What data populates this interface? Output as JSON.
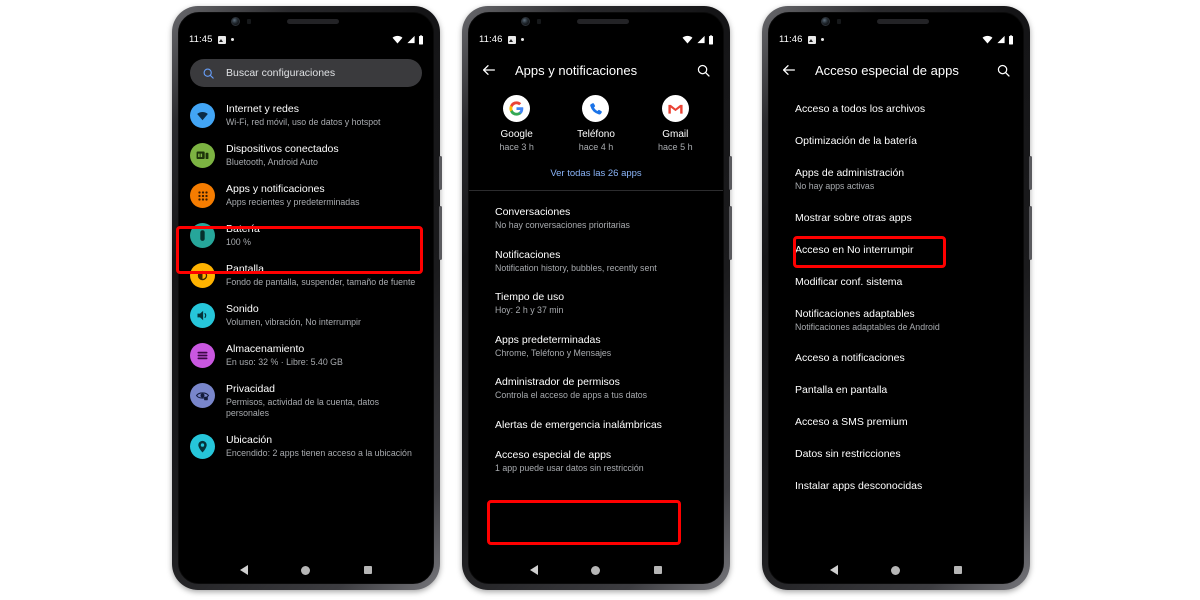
{
  "accent": {
    "red_highlight": "#ff0000",
    "link_blue": "#8ab4f8",
    "screen_bg": "#000000",
    "search_bg": "#3a3a3d",
    "secondary_text": "#a8abaf"
  },
  "phone1": {
    "status": {
      "time": "11:45",
      "icons": [
        "photo-icon",
        "dot-icon",
        "wifi-icon",
        "signal-icon",
        "battery-icon"
      ]
    },
    "search": {
      "placeholder": "Buscar configuraciones",
      "icon": "search-icon"
    },
    "settings": [
      {
        "title": "Internet y redes",
        "subtitle": "Wi-Fi, red móvil, uso de datos y hotspot",
        "icon": "wifi-icon",
        "color": "#42a5f5"
      },
      {
        "title": "Dispositivos conectados",
        "subtitle": "Bluetooth, Android Auto",
        "icon": "devices-icon",
        "color": "#7cb342"
      },
      {
        "title": "Apps y notificaciones",
        "subtitle": "Apps recientes y predeterminadas",
        "icon": "apps-grid-icon",
        "color": "#f57c00"
      },
      {
        "title": "Batería",
        "subtitle": "100 %",
        "icon": "battery-icon",
        "color": "#26a69a"
      },
      {
        "title": "Pantalla",
        "subtitle": "Fondo de pantalla, suspender, tamaño de fuente",
        "icon": "brightness-icon",
        "color": "#ffb300"
      },
      {
        "title": "Sonido",
        "subtitle": "Volumen, vibración, No interrumpir",
        "icon": "volume-icon",
        "color": "#26c6da"
      },
      {
        "title": "Almacenamiento",
        "subtitle": "En uso: 32 % · Libre: 5.40 GB",
        "icon": "storage-icon",
        "color": "#c957e0"
      },
      {
        "title": "Privacidad",
        "subtitle": "Permisos, actividad de la cuenta, datos personales",
        "icon": "privacy-eye-icon",
        "color": "#7986cb"
      },
      {
        "title": "Ubicación",
        "subtitle": "Encendido: 2 apps tienen acceso a la ubicación",
        "icon": "location-pin-icon",
        "color": "#26c6da"
      }
    ],
    "nav": {
      "back": "nav-back-icon",
      "home": "nav-home-icon",
      "recents": "nav-recents-icon"
    }
  },
  "phone2": {
    "status": {
      "time": "11:46"
    },
    "appbar": {
      "title": "Apps y notificaciones",
      "back_icon": "arrow-back-icon",
      "search_icon": "search-icon"
    },
    "recent_apps": [
      {
        "name": "Google",
        "time": "hace 3 h",
        "icon": "google-icon"
      },
      {
        "name": "Teléfono",
        "time": "hace 4 h",
        "icon": "phone-icon"
      },
      {
        "name": "Gmail",
        "time": "hace 5 h",
        "icon": "gmail-icon"
      }
    ],
    "see_all": "Ver todas las 26 apps",
    "items": [
      {
        "title": "Conversaciones",
        "subtitle": "No hay conversaciones prioritarias"
      },
      {
        "title": "Notificaciones",
        "subtitle": "Notification history, bubbles, recently sent"
      },
      {
        "title": "Tiempo de uso",
        "subtitle": "Hoy: 2 h y 37 min"
      },
      {
        "title": "Apps predeterminadas",
        "subtitle": "Chrome, Teléfono y Mensajes"
      },
      {
        "title": "Administrador de permisos",
        "subtitle": "Controla el acceso de apps a tus datos"
      },
      {
        "title": "Alertas de emergencia inalámbricas",
        "subtitle": ""
      },
      {
        "title": "Acceso especial de apps",
        "subtitle": "1 app puede usar datos sin restricción"
      }
    ]
  },
  "phone3": {
    "status": {
      "time": "11:46"
    },
    "appbar": {
      "title": "Acceso especial de apps",
      "back_icon": "arrow-back-icon",
      "search_icon": "search-icon"
    },
    "items": [
      {
        "title": "Acceso a todos los archivos",
        "subtitle": ""
      },
      {
        "title": "Optimización de la batería",
        "subtitle": ""
      },
      {
        "title": "Apps de administración",
        "subtitle": "No hay apps activas"
      },
      {
        "title": "Mostrar sobre otras apps",
        "subtitle": ""
      },
      {
        "title": "Acceso en No interrumpir",
        "subtitle": ""
      },
      {
        "title": "Modificar conf. sistema",
        "subtitle": ""
      },
      {
        "title": "Notificaciones adaptables",
        "subtitle": "Notificaciones adaptables de Android"
      },
      {
        "title": "Acceso a notificaciones",
        "subtitle": ""
      },
      {
        "title": "Pantalla en pantalla",
        "subtitle": ""
      },
      {
        "title": "Acceso a SMS premium",
        "subtitle": ""
      },
      {
        "title": "Datos sin restricciones",
        "subtitle": ""
      },
      {
        "title": "Instalar apps desconocidas",
        "subtitle": ""
      }
    ]
  }
}
